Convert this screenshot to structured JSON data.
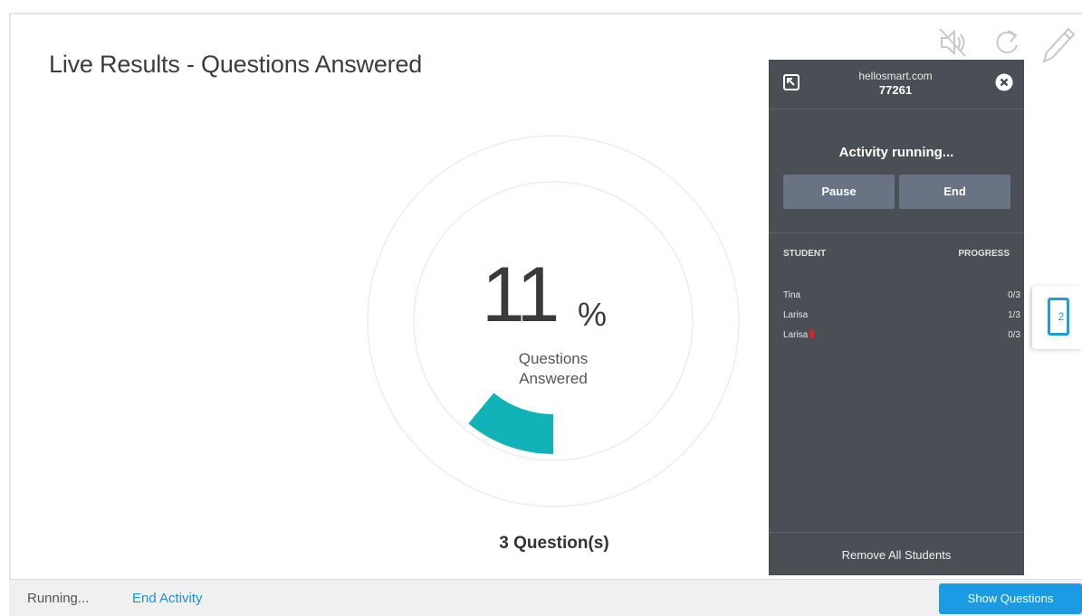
{
  "header": {
    "title": "Live Results - Questions Answered"
  },
  "toolbar": {
    "icons": [
      "mute-icon",
      "refresh-icon",
      "pencil-icon"
    ]
  },
  "results": {
    "percent_value": "11",
    "percent_symbol": "%",
    "label_line1": "Questions",
    "label_line2": "Answered",
    "question_count": "3 Question(s)",
    "progress_fraction": 0.11,
    "accent_color": "#12b3b8"
  },
  "panel": {
    "site": "hellosmart.com",
    "code": "77261",
    "status": "Activity running...",
    "pause_label": "Pause",
    "end_label": "End",
    "col_student": "STUDENT",
    "col_progress": "PROGRESS",
    "students": [
      {
        "name": "Tina",
        "progress": "0/3",
        "flag": false
      },
      {
        "name": "Larisa",
        "progress": "1/3",
        "flag": false
      },
      {
        "name": "Larisa",
        "progress": "0/3",
        "flag": true
      }
    ],
    "remove_label": "Remove All Students",
    "background_color": "#4a4f55"
  },
  "side_tab": {
    "count": "2",
    "icon": "device-icon"
  },
  "footer": {
    "status": "Running...",
    "end_activity": "End Activity",
    "show_questions": "Show Questions"
  }
}
